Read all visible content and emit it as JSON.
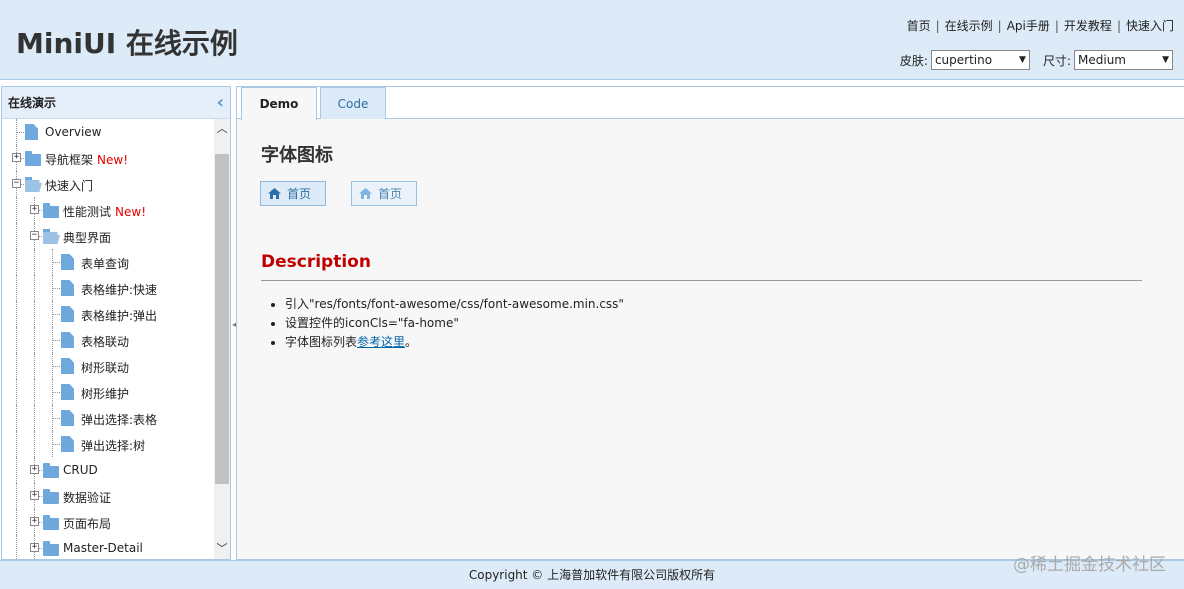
{
  "header": {
    "title": "MiniUI 在线示例",
    "links": [
      "首页",
      "在线示例",
      "Api手册",
      "开发教程",
      "快速入门"
    ],
    "skin_label": "皮肤:",
    "skin_value": "cupertino",
    "size_label": "尺寸:",
    "size_value": "Medium"
  },
  "sidebar": {
    "title": "在线演示",
    "items": [
      {
        "label": "Overview",
        "level": 0,
        "type": "file"
      },
      {
        "label": "导航框架",
        "badge": "New!",
        "level": 0,
        "type": "folder",
        "expanded": false
      },
      {
        "label": "快速入门",
        "level": 0,
        "type": "folder",
        "expanded": true
      },
      {
        "label": "性能测试",
        "badge": "New!",
        "level": 1,
        "type": "folder",
        "expanded": false
      },
      {
        "label": "典型界面",
        "level": 1,
        "type": "folder",
        "expanded": true
      },
      {
        "label": "表单查询",
        "level": 2,
        "type": "file"
      },
      {
        "label": "表格维护:快速",
        "level": 2,
        "type": "file"
      },
      {
        "label": "表格维护:弹出",
        "level": 2,
        "type": "file"
      },
      {
        "label": "表格联动",
        "level": 2,
        "type": "file"
      },
      {
        "label": "树形联动",
        "level": 2,
        "type": "file"
      },
      {
        "label": "树形维护",
        "level": 2,
        "type": "file"
      },
      {
        "label": "弹出选择:表格",
        "level": 2,
        "type": "file"
      },
      {
        "label": "弹出选择:树",
        "level": 2,
        "type": "file"
      },
      {
        "label": "CRUD",
        "level": 1,
        "type": "folder",
        "expanded": false
      },
      {
        "label": "数据验证",
        "level": 1,
        "type": "folder",
        "expanded": false
      },
      {
        "label": "页面布局",
        "level": 1,
        "type": "folder",
        "expanded": false
      },
      {
        "label": "Master-Detail",
        "level": 1,
        "type": "folder",
        "expanded": false
      }
    ]
  },
  "tabs": {
    "demo": "Demo",
    "code": "Code"
  },
  "main": {
    "title": "字体图标",
    "button1": "首页",
    "button2": "首页",
    "desc_title": "Description",
    "desc_items": [
      "引入\"res/fonts/font-awesome/css/font-awesome.min.css\"",
      "设置控件的iconCls=\"fa-home\"",
      "字体图标列表"
    ],
    "desc_link": "参考这里",
    "desc_suffix": "。"
  },
  "footer": {
    "copyright": "Copyright © 上海普加软件有限公司版权所有"
  },
  "watermark": "@稀土掘金技术社区",
  "colors": {
    "header_bg": "#dcebf7",
    "accent": "#2d6fa6",
    "desc_title": "#c00000",
    "icon_blue": "#6fa8dc",
    "new_badge": "#e60000"
  }
}
